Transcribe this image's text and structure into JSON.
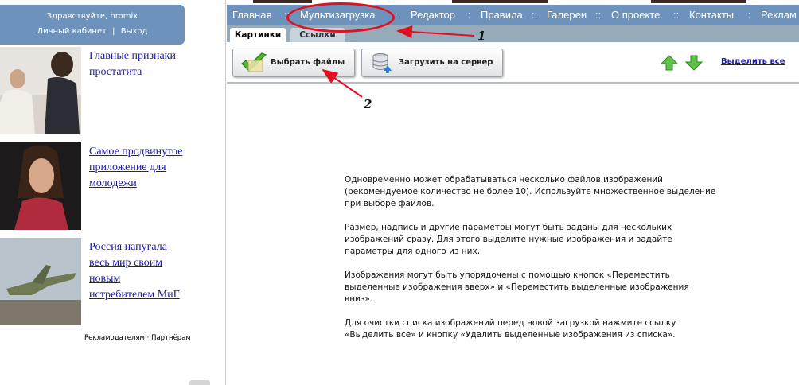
{
  "sidebar": {
    "greeting": "Здравствуйте, hromix",
    "cabinet_link": "Личный кабинет",
    "link_separator": "|",
    "logout_link": "Выход",
    "news": [
      {
        "title": "Главные признаки простатита"
      },
      {
        "title": "Самое продвинутое приложение для молодежи"
      },
      {
        "title": "Россия напугала весь мир своим новым истребителем МиГ"
      }
    ],
    "advertisers_link": "Рекламодателям",
    "ad_separator": "·",
    "partners_link": "Партнёрам"
  },
  "nav": {
    "items": [
      "Главная",
      "Мультизагрузка",
      "Редактор",
      "Правила",
      "Галереи",
      "О проекте",
      "Контакты",
      "Реклам"
    ],
    "separator": "::"
  },
  "tabs": {
    "pictures": "Картинки",
    "links": "Ссылки"
  },
  "toolbar": {
    "select_files": "Выбрать файлы",
    "upload_to_server": "Загрузить на сервер",
    "select_all": "Выделить все",
    "move_up_icon": "green-arrow-up",
    "move_down_icon": "green-arrow-down"
  },
  "info": [
    "Одновременно может обрабатываться несколько файлов изображений (рекомендуемое количество не более 10). Используйте множественное выделение при выборе файлов.",
    "Размер, надпись и другие параметры могут быть заданы для нескольких изображений сразу. Для этого выделите нужные изображения и задайте параметры для одного из них.",
    "Изображения могут быть упорядочены с помощью кнопок «Переместить выделенные изображения вверх» и «Переместить выделенные изображения вниз».",
    "Для очистки списка изображений перед новой загрузкой нажмите ссылку «Выделить все» и кнопку «Удалить выделенные изображения из списка»."
  ],
  "annotations": {
    "label1": "1",
    "label2": "2",
    "color": "#e01020"
  },
  "colors": {
    "nav_bg": "#6d93bd",
    "tab_row_bg": "#96aaba",
    "link": "#1a1aa6"
  }
}
